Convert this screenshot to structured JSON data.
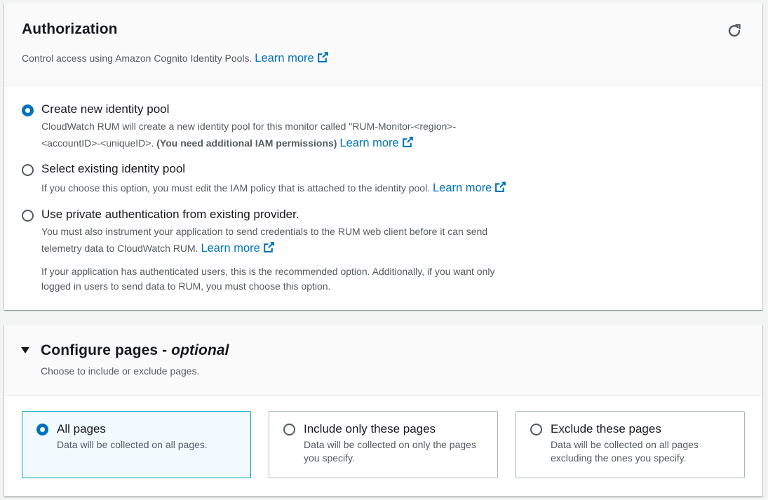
{
  "authorization": {
    "title": "Authorization",
    "description": "Control access using Amazon Cognito Identity Pools.",
    "learn_more": "Learn more",
    "refresh_icon": "refresh-icon",
    "options": [
      {
        "label": "Create new identity pool",
        "checked": true,
        "desc_part1": "CloudWatch RUM will create a new identity pool for this monitor called \"RUM-Monitor-<region>-",
        "desc_part2": "<accountID>-<uniqueID>.",
        "desc_bold": "(You need additional IAM permissions)",
        "learn_more": "Learn more"
      },
      {
        "label": "Select existing identity pool",
        "checked": false,
        "desc": "If you choose this option, you must edit the IAM policy that is attached to the identity pool.",
        "learn_more": "Learn more"
      },
      {
        "label": "Use private authentication from existing provider.",
        "checked": false,
        "desc_line1": "You must also instrument your application to send credentials to the RUM web client before it can send",
        "desc_line2": "telemetry data to CloudWatch RUM.",
        "learn_more": "Learn more",
        "note_line1": "If your application has authenticated users, this is the recommended option. Additionally, if you want only",
        "note_line2": "logged in users to send data to RUM, you must choose this option."
      }
    ]
  },
  "configure_pages": {
    "title": "Configure pages - ",
    "title_optional": "optional",
    "description": "Choose to include or exclude pages.",
    "tiles": [
      {
        "label": "All pages",
        "desc": "Data will be collected on all pages.",
        "selected": true
      },
      {
        "label": "Include only these pages",
        "desc": "Data will be collected on only the pages you specify.",
        "selected": false
      },
      {
        "label": "Exclude these pages",
        "desc": "Data will be collected on all pages excluding the ones you specify.",
        "selected": false
      }
    ]
  },
  "colors": {
    "link": "#0073bb",
    "radio_checked": "#0073bb",
    "tile_selected_bg": "#f1faff",
    "tile_selected_border": "#00a1c9"
  }
}
